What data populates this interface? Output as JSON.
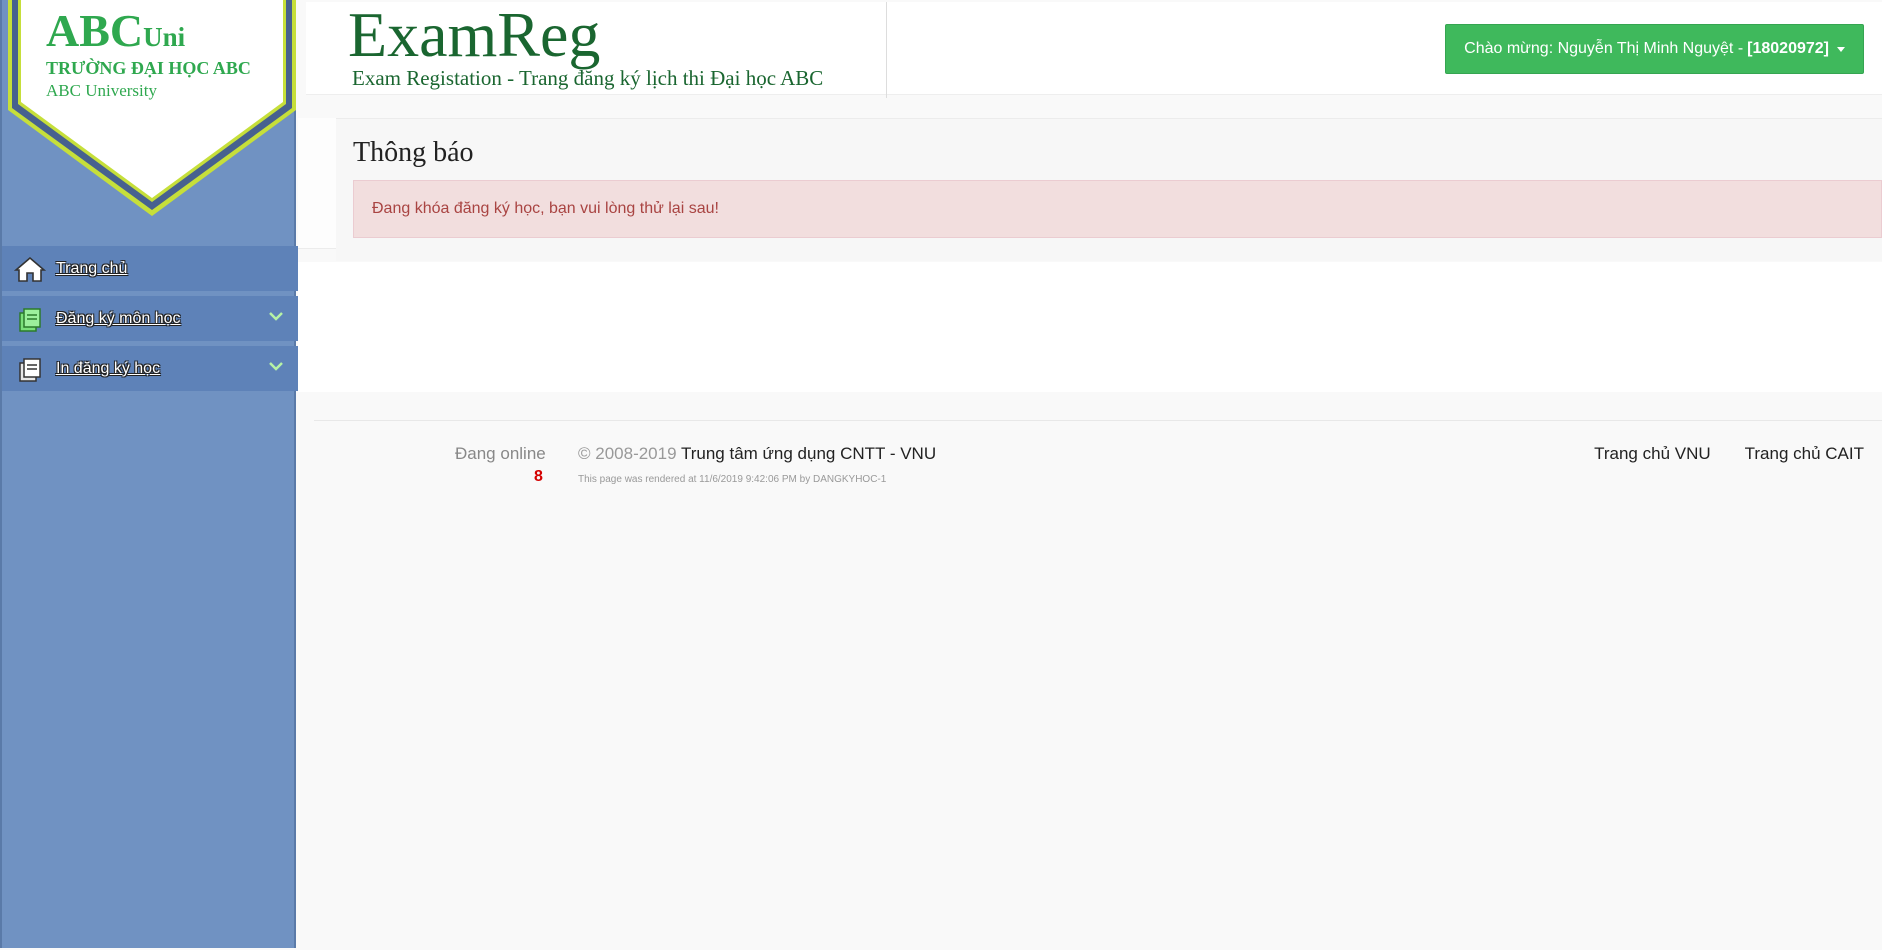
{
  "logo": {
    "abc": "ABC",
    "uni": "Uni",
    "school": "TRƯỜNG ĐẠI HỌC ABC",
    "english": "ABC University"
  },
  "sidebar": {
    "items": [
      {
        "label": "Trang chủ",
        "icon": "home-icon"
      },
      {
        "label": "Đăng ký môn học",
        "icon": "register-icon"
      },
      {
        "label": "In đăng ký học",
        "icon": "print-icon"
      }
    ]
  },
  "header": {
    "title": "ExamReg",
    "subtitle": "Exam Registation - Trang đăng ký lịch thi Đại học ABC",
    "welcome_prefix": "Chào mừng: Nguyễn Thị Minh Nguyệt -",
    "welcome_id": "[18020972]"
  },
  "notice": {
    "title": "Thông báo",
    "message": "Đang khóa đăng ký học, bạn vui lòng thử lại sau!"
  },
  "footer": {
    "online_label": "Đang online",
    "online_count": "8",
    "copyright_prefix": "© 2008-2019",
    "copyright_org": "Trung tâm ứng dụng CNTT - VNU",
    "rendered": "This page was rendered at 11/6/2019 9:42:06 PM by DANGKYHOC-1",
    "links": [
      "Trang chủ VNU",
      "Trang chủ CAIT"
    ]
  },
  "colors": {
    "sidebar": "#7092c2",
    "menu_item": "#5e82b8",
    "brand_green": "#1a6630",
    "button_green": "#3fb95c",
    "alert_bg": "#f2dede",
    "alert_text": "#a94442"
  }
}
